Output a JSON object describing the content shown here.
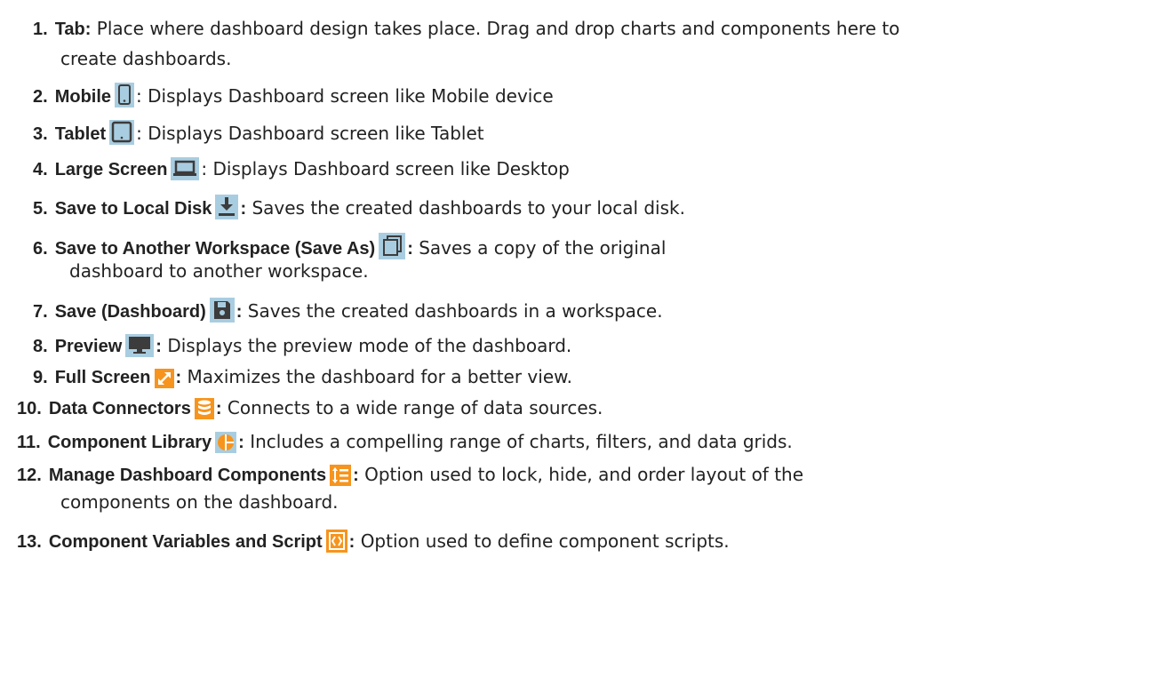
{
  "items": [
    {
      "number": "1.",
      "term": "Tab:",
      "icon": "",
      "desc": "Place where dashboard design takes place. Drag and drop charts and components here to",
      "desc2": "create dashboards."
    },
    {
      "number": "2.",
      "term": "Mobile",
      "icon": "mobile-icon",
      "desc": ": Displays Dashboard screen like Mobile device"
    },
    {
      "number": "3.",
      "term": "Tablet",
      "icon": "tablet-icon",
      "desc": ": Displays Dashboard screen like Tablet"
    },
    {
      "number": "4.",
      "term": "Large Screen",
      "icon": "laptop-icon",
      "desc": ": Displays Dashboard screen like Desktop"
    },
    {
      "number": "5.",
      "term": "Save to Local Disk",
      "icon": "download-icon",
      "colon": ":",
      "desc": "Saves the created dashboards to your local disk."
    },
    {
      "number": "6.",
      "term": "Save to Another Workspace (Save As)",
      "icon": "copy-icon",
      "colon": ":",
      "desc": "Saves a copy of the original",
      "desc2": "dashboard to another workspace."
    },
    {
      "number": "7.",
      "term": "Save (Dashboard)",
      "icon": "save-icon",
      "colon": ":",
      "desc": "Saves the created dashboards in a workspace."
    },
    {
      "number": "8.",
      "term": "Preview",
      "icon": "monitor-icon",
      "colon": ":",
      "desc": "Displays the preview mode of the dashboard."
    },
    {
      "number": "9.",
      "term": "Full Screen",
      "icon": "fullscreen-icon",
      "colon": ":",
      "desc": "Maximizes the dashboard for a better view."
    },
    {
      "number": "10.",
      "term": "Data Connectors",
      "icon": "database-icon",
      "colon": ":",
      "desc": "Connects to a wide range of data sources."
    },
    {
      "number": "11.",
      "term": "Component Library",
      "icon": "pie-chart-icon",
      "colon": ":",
      "desc": "Includes a compelling range of charts, filters, and data grids."
    },
    {
      "number": "12.",
      "term": "Manage Dashboard Components",
      "icon": "list-order-icon",
      "colon": ":",
      "desc": "Option used to lock, hide, and order layout of the",
      "desc2": "components on the dashboard."
    },
    {
      "number": "13.",
      "term": "Component Variables and Script",
      "icon": "script-icon",
      "colon": ":",
      "desc": "Option used to define component scripts."
    }
  ],
  "colors": {
    "blue_icon_bg": "#a9cde0",
    "orange_icon_bg": "#f7941d",
    "icon_dark": "#3c3c3c"
  }
}
